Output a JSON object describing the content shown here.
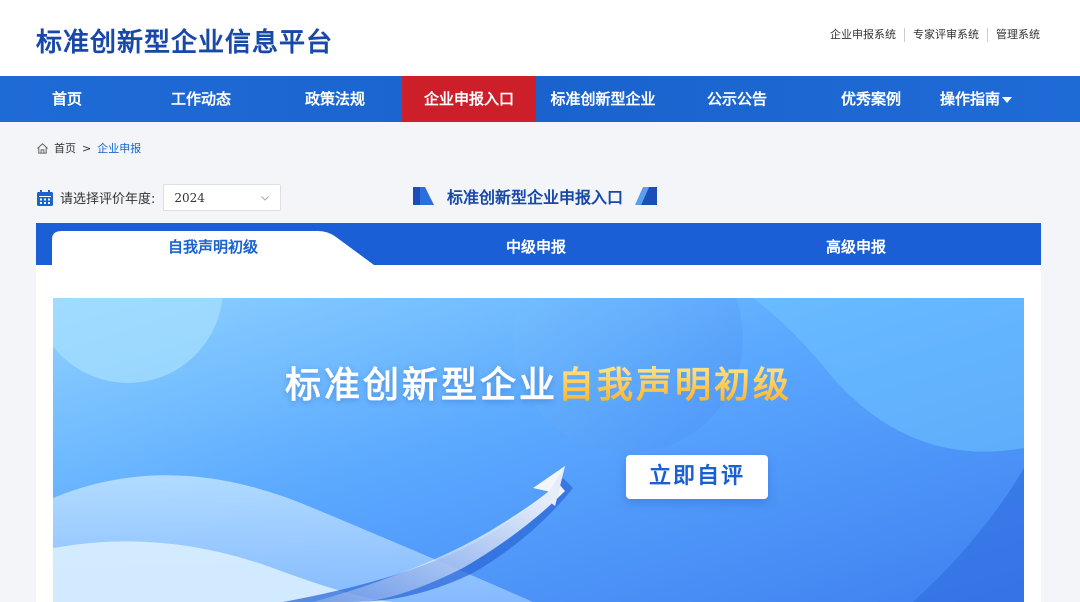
{
  "header": {
    "title": "标准创新型企业信息平台",
    "links": [
      "企业申报系统",
      "专家评审系统",
      "管理系统"
    ]
  },
  "nav": {
    "items": [
      "首页",
      "工作动态",
      "政策法规",
      "企业申报入口",
      "标准创新型企业",
      "公示公告",
      "优秀案例",
      "操作指南"
    ],
    "active_index": 3
  },
  "breadcrumb": {
    "home": "首页",
    "separator": ">",
    "current": "企业申报"
  },
  "year_select": {
    "label": "请选择评价年度:",
    "value": "2024"
  },
  "section_title": "标准创新型企业申报入口",
  "tabs": [
    "自我声明初级",
    "中级申报",
    "高级申报"
  ],
  "banner": {
    "title_part1": "标准创新型企业",
    "title_part2": "自我声明初级",
    "cta_label": "立即自评"
  },
  "colors": {
    "brand_blue": "#1a63cf",
    "title_blue": "#1848a8",
    "active_red": "#cc1f2a",
    "accent_gold": "#ffc93a"
  },
  "icons": [
    "home-icon",
    "calendar-icon",
    "chevron-down-icon",
    "caret-down-icon",
    "paper-plane-icon"
  ]
}
